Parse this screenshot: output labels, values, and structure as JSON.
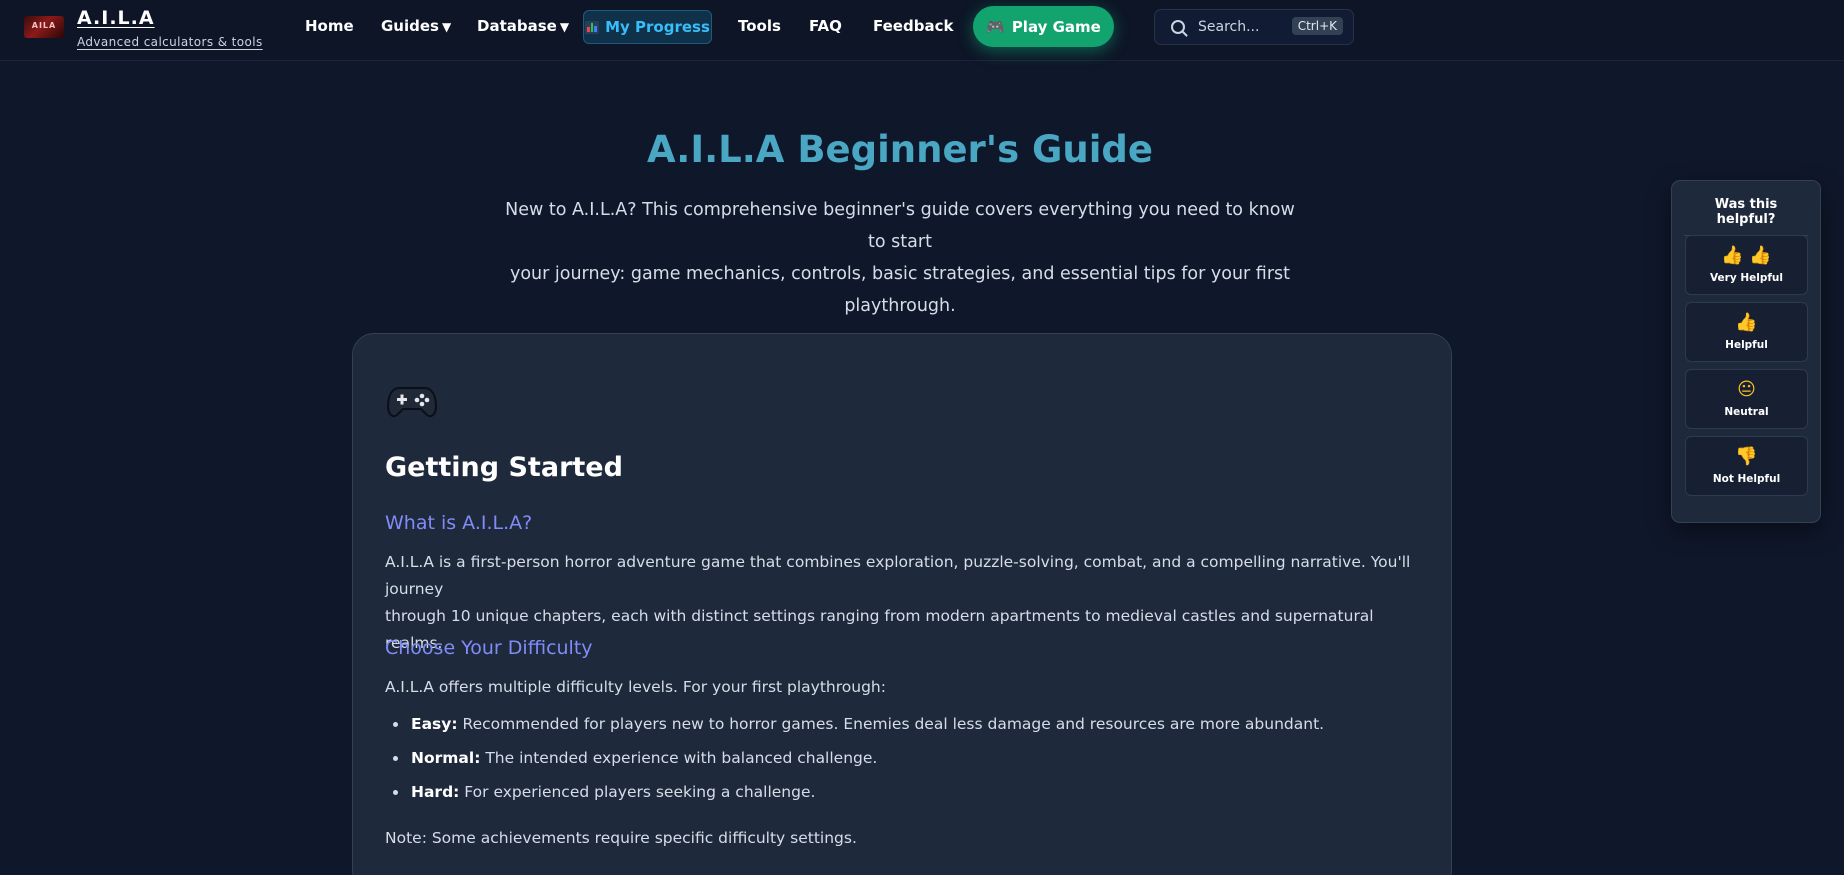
{
  "brand": {
    "logo_text": "AILA",
    "title": "A.I.L.A",
    "subtitle": "Advanced calculators & tools"
  },
  "nav": {
    "home": "Home",
    "guides": "Guides",
    "database": "Database",
    "my_progress": "My Progress",
    "tools": "Tools",
    "faq": "FAQ",
    "feedback": "Feedback",
    "caret": "▼"
  },
  "play_button": {
    "icon": "🎮",
    "label": "Play Game"
  },
  "search": {
    "placeholder": "Search...",
    "shortcut": "Ctrl+K"
  },
  "hero": {
    "title": "A.I.L.A Beginner's Guide",
    "subtitle_line1": "New to A.I.L.A? This comprehensive beginner's guide covers everything you need to know to start",
    "subtitle_line2": "your journey: game mechanics, controls, basic strategies, and essential tips for your first",
    "subtitle_line3": "playthrough."
  },
  "section": {
    "icon": "🎮",
    "heading": "Getting Started",
    "what_is_heading": "What is A.I.L.A?",
    "what_is_line1": "A.I.L.A is a first-person horror adventure game that combines exploration, puzzle-solving, combat, and a compelling narrative. You'll journey",
    "what_is_line2": "through 10 unique chapters, each with distinct settings ranging from modern apartments to medieval castles and supernatural realms.",
    "difficulty_heading": "Choose Your Difficulty",
    "difficulty_intro": "A.I.L.A offers multiple difficulty levels. For your first playthrough:",
    "difficulties": [
      {
        "name": "Easy:",
        "desc": " Recommended for players new to horror games. Enemies deal less damage and resources are more abundant."
      },
      {
        "name": "Normal:",
        "desc": " The intended experience with balanced challenge."
      },
      {
        "name": "Hard:",
        "desc": " For experienced players seeking a challenge."
      }
    ],
    "note": "Note: Some achievements require specific difficulty settings."
  },
  "feedback_panel": {
    "title": "Was this helpful?",
    "options": [
      {
        "emoji": "👍 👍",
        "label": "Very Helpful"
      },
      {
        "emoji": "👍",
        "label": "Helpful"
      },
      {
        "emoji": "😐",
        "label": "Neutral"
      },
      {
        "emoji": "👎",
        "label": "Not Helpful"
      }
    ]
  }
}
